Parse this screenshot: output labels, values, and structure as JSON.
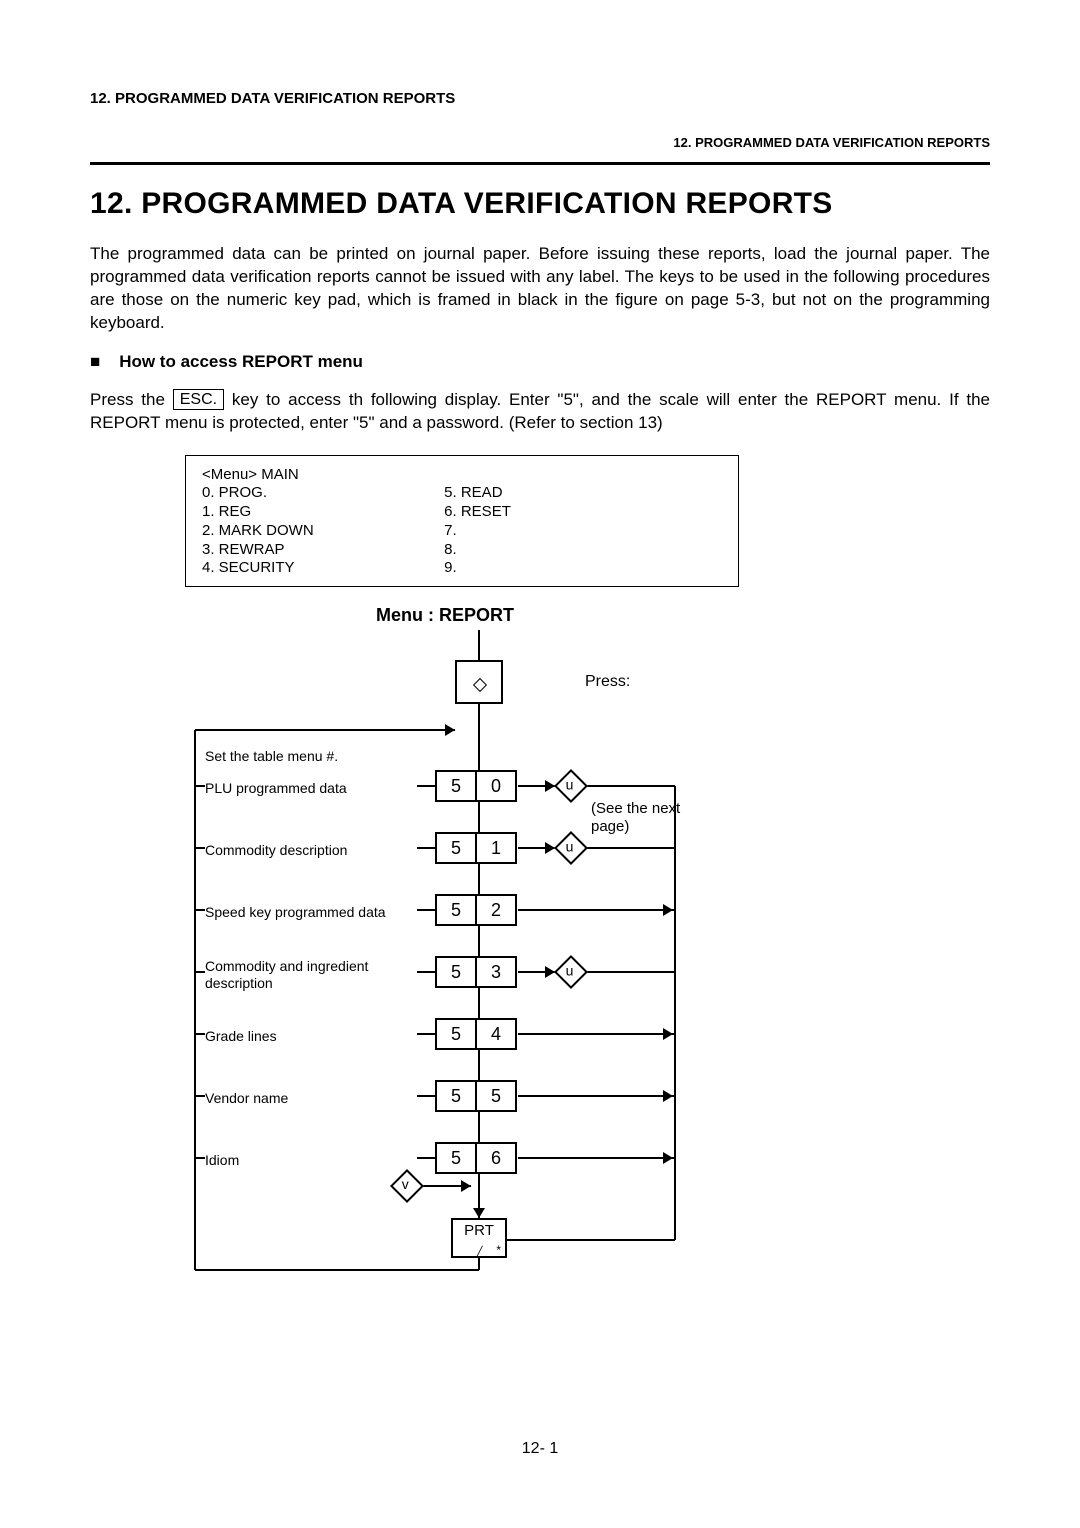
{
  "header_small": "12.  PROGRAMMED DATA VERIFICATION REPORTS",
  "header_sub": "12. PROGRAMMED DATA VERIFICATION REPORTS",
  "chapter_title": "12.  PROGRAMMED DATA VERIFICATION REPORTS",
  "para1": "The programmed data can be printed on journal paper.   Before issuing these reports, load the journal paper.   The programmed data verification reports cannot be issued with any label.   The keys to be used in the following procedures are those on the numeric key pad, which is framed in black in the figure on page 5-3, but not on the programming keyboard.",
  "howto_bullet": "■",
  "howto_label": "How to access REPORT menu",
  "para2_pre": "Press the ",
  "esc_key": "ESC.",
  "para2_post": " key to access th following display.   Enter \"5\", and the scale will enter the REPORT menu.   If the REPORT menu is protected, enter \"5\" and a password.   (Refer to section 13)",
  "menu_box": {
    "head": "<Menu>   MAIN",
    "left": [
      "0.  PROG.",
      "1.  REG",
      "2.  MARK DOWN",
      "3.  REWRAP",
      "4.  SECURITY"
    ],
    "right": [
      "5.  READ",
      "6.  RESET",
      "7.",
      "8.",
      "9."
    ]
  },
  "menu_title": "Menu :   REPORT",
  "diagram": {
    "press_label": "Press:",
    "set_label": "Set the table menu #.",
    "rows": [
      {
        "label": "PLU programmed data",
        "k1": "5",
        "k2": "0",
        "u": true
      },
      {
        "label": "Commodity description",
        "k1": "5",
        "k2": "1",
        "u": true
      },
      {
        "label": "Speed key programmed data",
        "k1": "5",
        "k2": "2",
        "u": false
      },
      {
        "label": "Commodity and ingredient\ndescription",
        "k1": "5",
        "k2": "3",
        "u": true
      },
      {
        "label": "Grade lines",
        "k1": "5",
        "k2": "4",
        "u": false
      },
      {
        "label": "Vendor name",
        "k1": "5",
        "k2": "5",
        "u": false
      },
      {
        "label": "Idiom",
        "k1": "5",
        "k2": "6",
        "u": false
      }
    ],
    "see_next": "(See the next page)",
    "v": "v",
    "u": "u",
    "prt": "PRT"
  },
  "page_num": "12- 1"
}
